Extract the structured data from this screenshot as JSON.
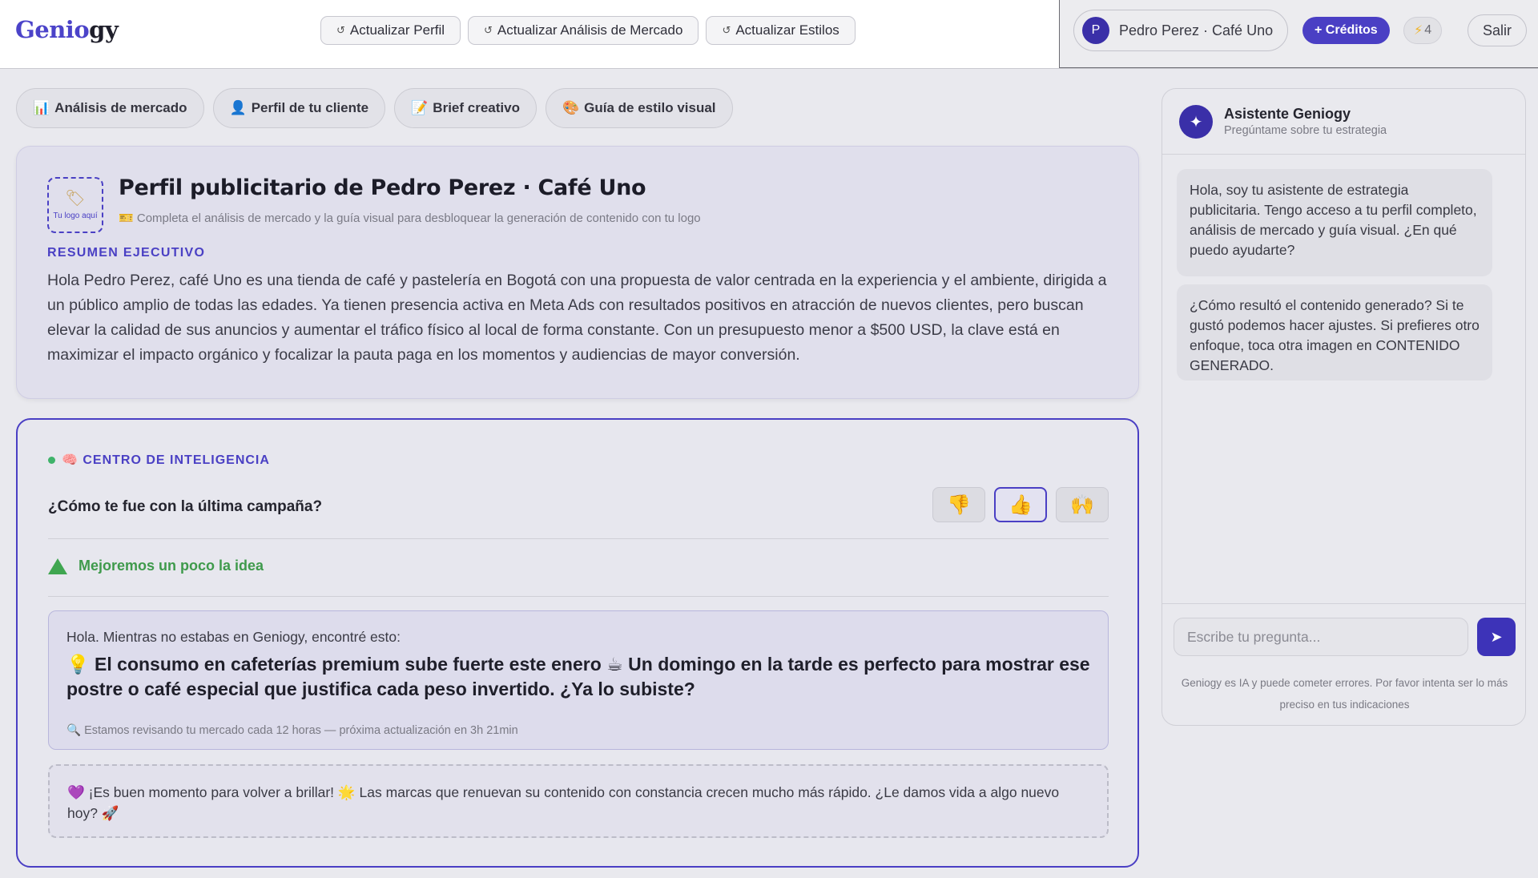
{
  "brand": {
    "part1": "Genio",
    "part2": "gy"
  },
  "top_actions": [
    {
      "icon": "↺",
      "label": "Actualizar Perfil"
    },
    {
      "icon": "↺",
      "label": "Actualizar Análisis de Mercado"
    },
    {
      "icon": "↺",
      "label": "Actualizar Estilos"
    }
  ],
  "user": {
    "initial": "P",
    "name": "Pedro Perez · Café Uno",
    "credits_button": "+ Créditos",
    "credits_count": "4",
    "logout": "Salir"
  },
  "tabs": [
    {
      "icon": "📊",
      "label": "Análisis de mercado"
    },
    {
      "icon": "👤",
      "label": "Perfil de tu cliente"
    },
    {
      "icon": "📝",
      "label": "Brief creativo"
    },
    {
      "icon": "🎨",
      "label": "Guía de estilo visual"
    }
  ],
  "profile": {
    "logo_placeholder": "Tu logo aquí",
    "title": "Perfil publicitario de Pedro Perez · Café Uno",
    "subtitle": "Completa el análisis de mercado y la guía visual para desbloquear la generación de contenido con tu logo",
    "exec_label": "RESUMEN EJECUTIVO",
    "exec_text": "Hola Pedro Perez, café Uno es una tienda de café y pastelería en Bogotá con una propuesta de valor centrada en la experiencia y el ambiente, dirigida a un público amplio de todas las edades. Ya tienen presencia activa en Meta Ads con resultados positivos en atracción de nuevos clientes, pero buscan elevar la calidad de sus anuncios y aumentar el tráfico físico al local de forma constante. Con un presupuesto menor a $500 USD, la clave está en maximizar el impacto orgánico y focalizar la pauta paga en los momentos y audiencias de mayor conversión."
  },
  "intel": {
    "header": "🧠 CENTRO DE INTELIGENCIA",
    "question": "¿Cómo te fue con la última campaña?",
    "reactions": [
      "👎",
      "👍",
      "🙌"
    ],
    "improve": "Mejoremos un poco la idea",
    "insight_intro": "Hola. Mientras no estabas en Geniogy, encontré esto:",
    "insight_headline": "💡 El consumo en cafeterías premium sube fuerte este enero ☕ Un domingo en la tarde es perfecto para mostrar ese postre o café especial que justifica cada peso invertido. ¿Ya lo subiste?",
    "insight_note": "🔍 Estamos revisando tu mercado cada 12 horas — próxima actualización en 3h 21min",
    "motivation": "💜 ¡Es buen momento para volver a brillar! 🌟 Las marcas que renuevan su contenido con constancia crecen mucho más rápido. ¿Le damos vida a algo nuevo hoy? 🚀"
  },
  "assistant": {
    "icon": "✦",
    "title": "Asistente Geniogy",
    "subtitle": "Pregúntame sobre tu estrategia",
    "messages": [
      "Hola, soy tu asistente de estrategia publicitaria. Tengo acceso a tu perfil completo, análisis de mercado y guía visual. ¿En qué puedo ayudarte?",
      "¿Cómo resultó el contenido generado? Si te gustó podemos hacer ajustes. Si prefieres otro enfoque, toca otra imagen en CONTENIDO GENERADO."
    ],
    "input_placeholder": "Escribe tu pregunta...",
    "send_icon": "➤",
    "disclaimer": "Geniogy es IA y puede cometer errores. Por favor intenta ser lo más preciso en tus indicaciones"
  },
  "colors": {
    "accent": "#4a3fc4",
    "success": "#3fa650",
    "credit_bolt": "#f0b429"
  }
}
